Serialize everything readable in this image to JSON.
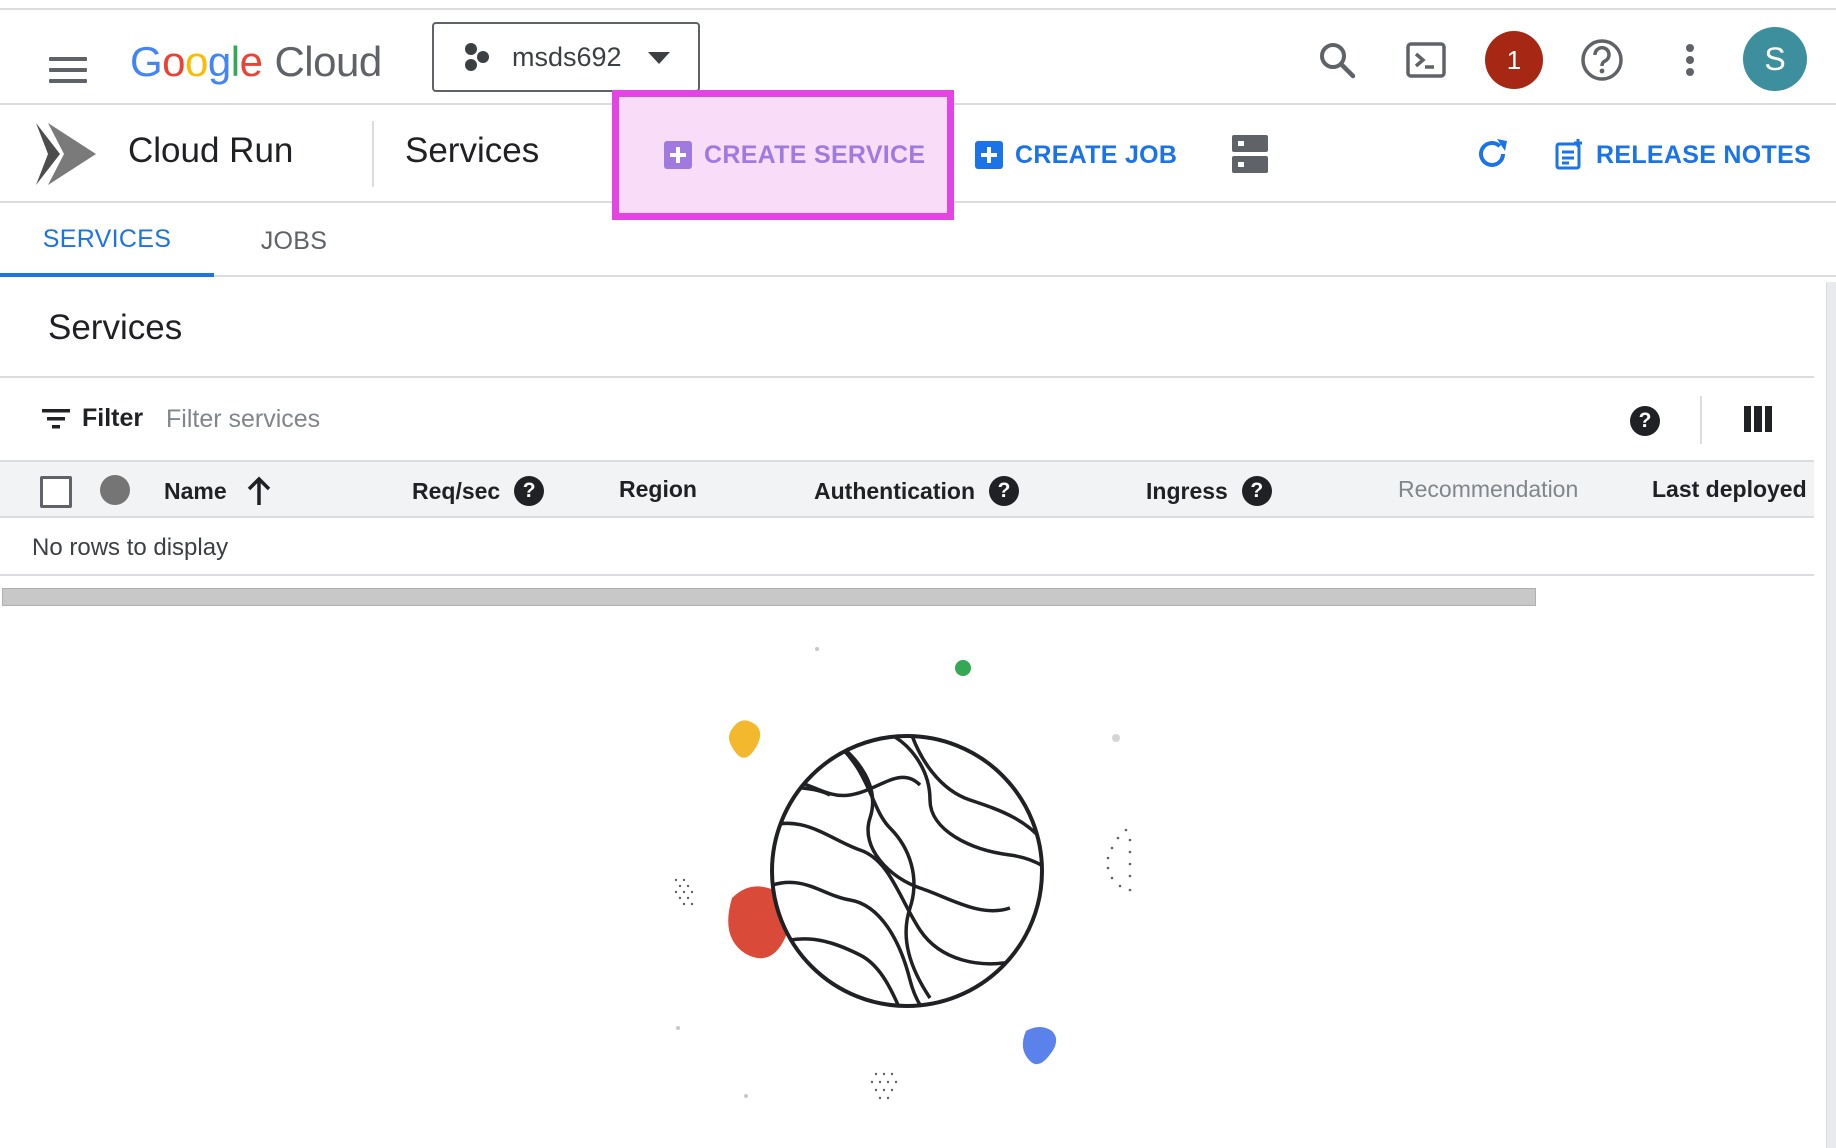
{
  "header": {
    "logo_google": [
      "G",
      "o",
      "o",
      "g",
      "l",
      "e"
    ],
    "logo_cloud": "Cloud",
    "project_name": "msds692",
    "notification_count": "1",
    "avatar_letter": "S"
  },
  "toolbar": {
    "product_title": "Cloud Run",
    "page_title": "Services",
    "create_service_label": "CREATE SERVICE",
    "create_job_label": "CREATE JOB",
    "release_notes_label": "RELEASE NOTES"
  },
  "tabs": [
    {
      "label": "SERVICES",
      "active": true
    },
    {
      "label": "JOBS",
      "active": false
    }
  ],
  "services": {
    "section_title": "Services",
    "filter_label": "Filter",
    "filter_placeholder": "Filter services",
    "columns": [
      "Name",
      "Req/sec",
      "Region",
      "Authentication",
      "Ingress",
      "Recommendation",
      "Last deployed"
    ],
    "empty_message": "No rows to display"
  },
  "colors": {
    "accent": "#1a73e8",
    "highlight_border": "#e444e4",
    "highlight_fill": "#f9dcf7",
    "avatar": "#3d8f9e",
    "notification": "#a52714"
  }
}
